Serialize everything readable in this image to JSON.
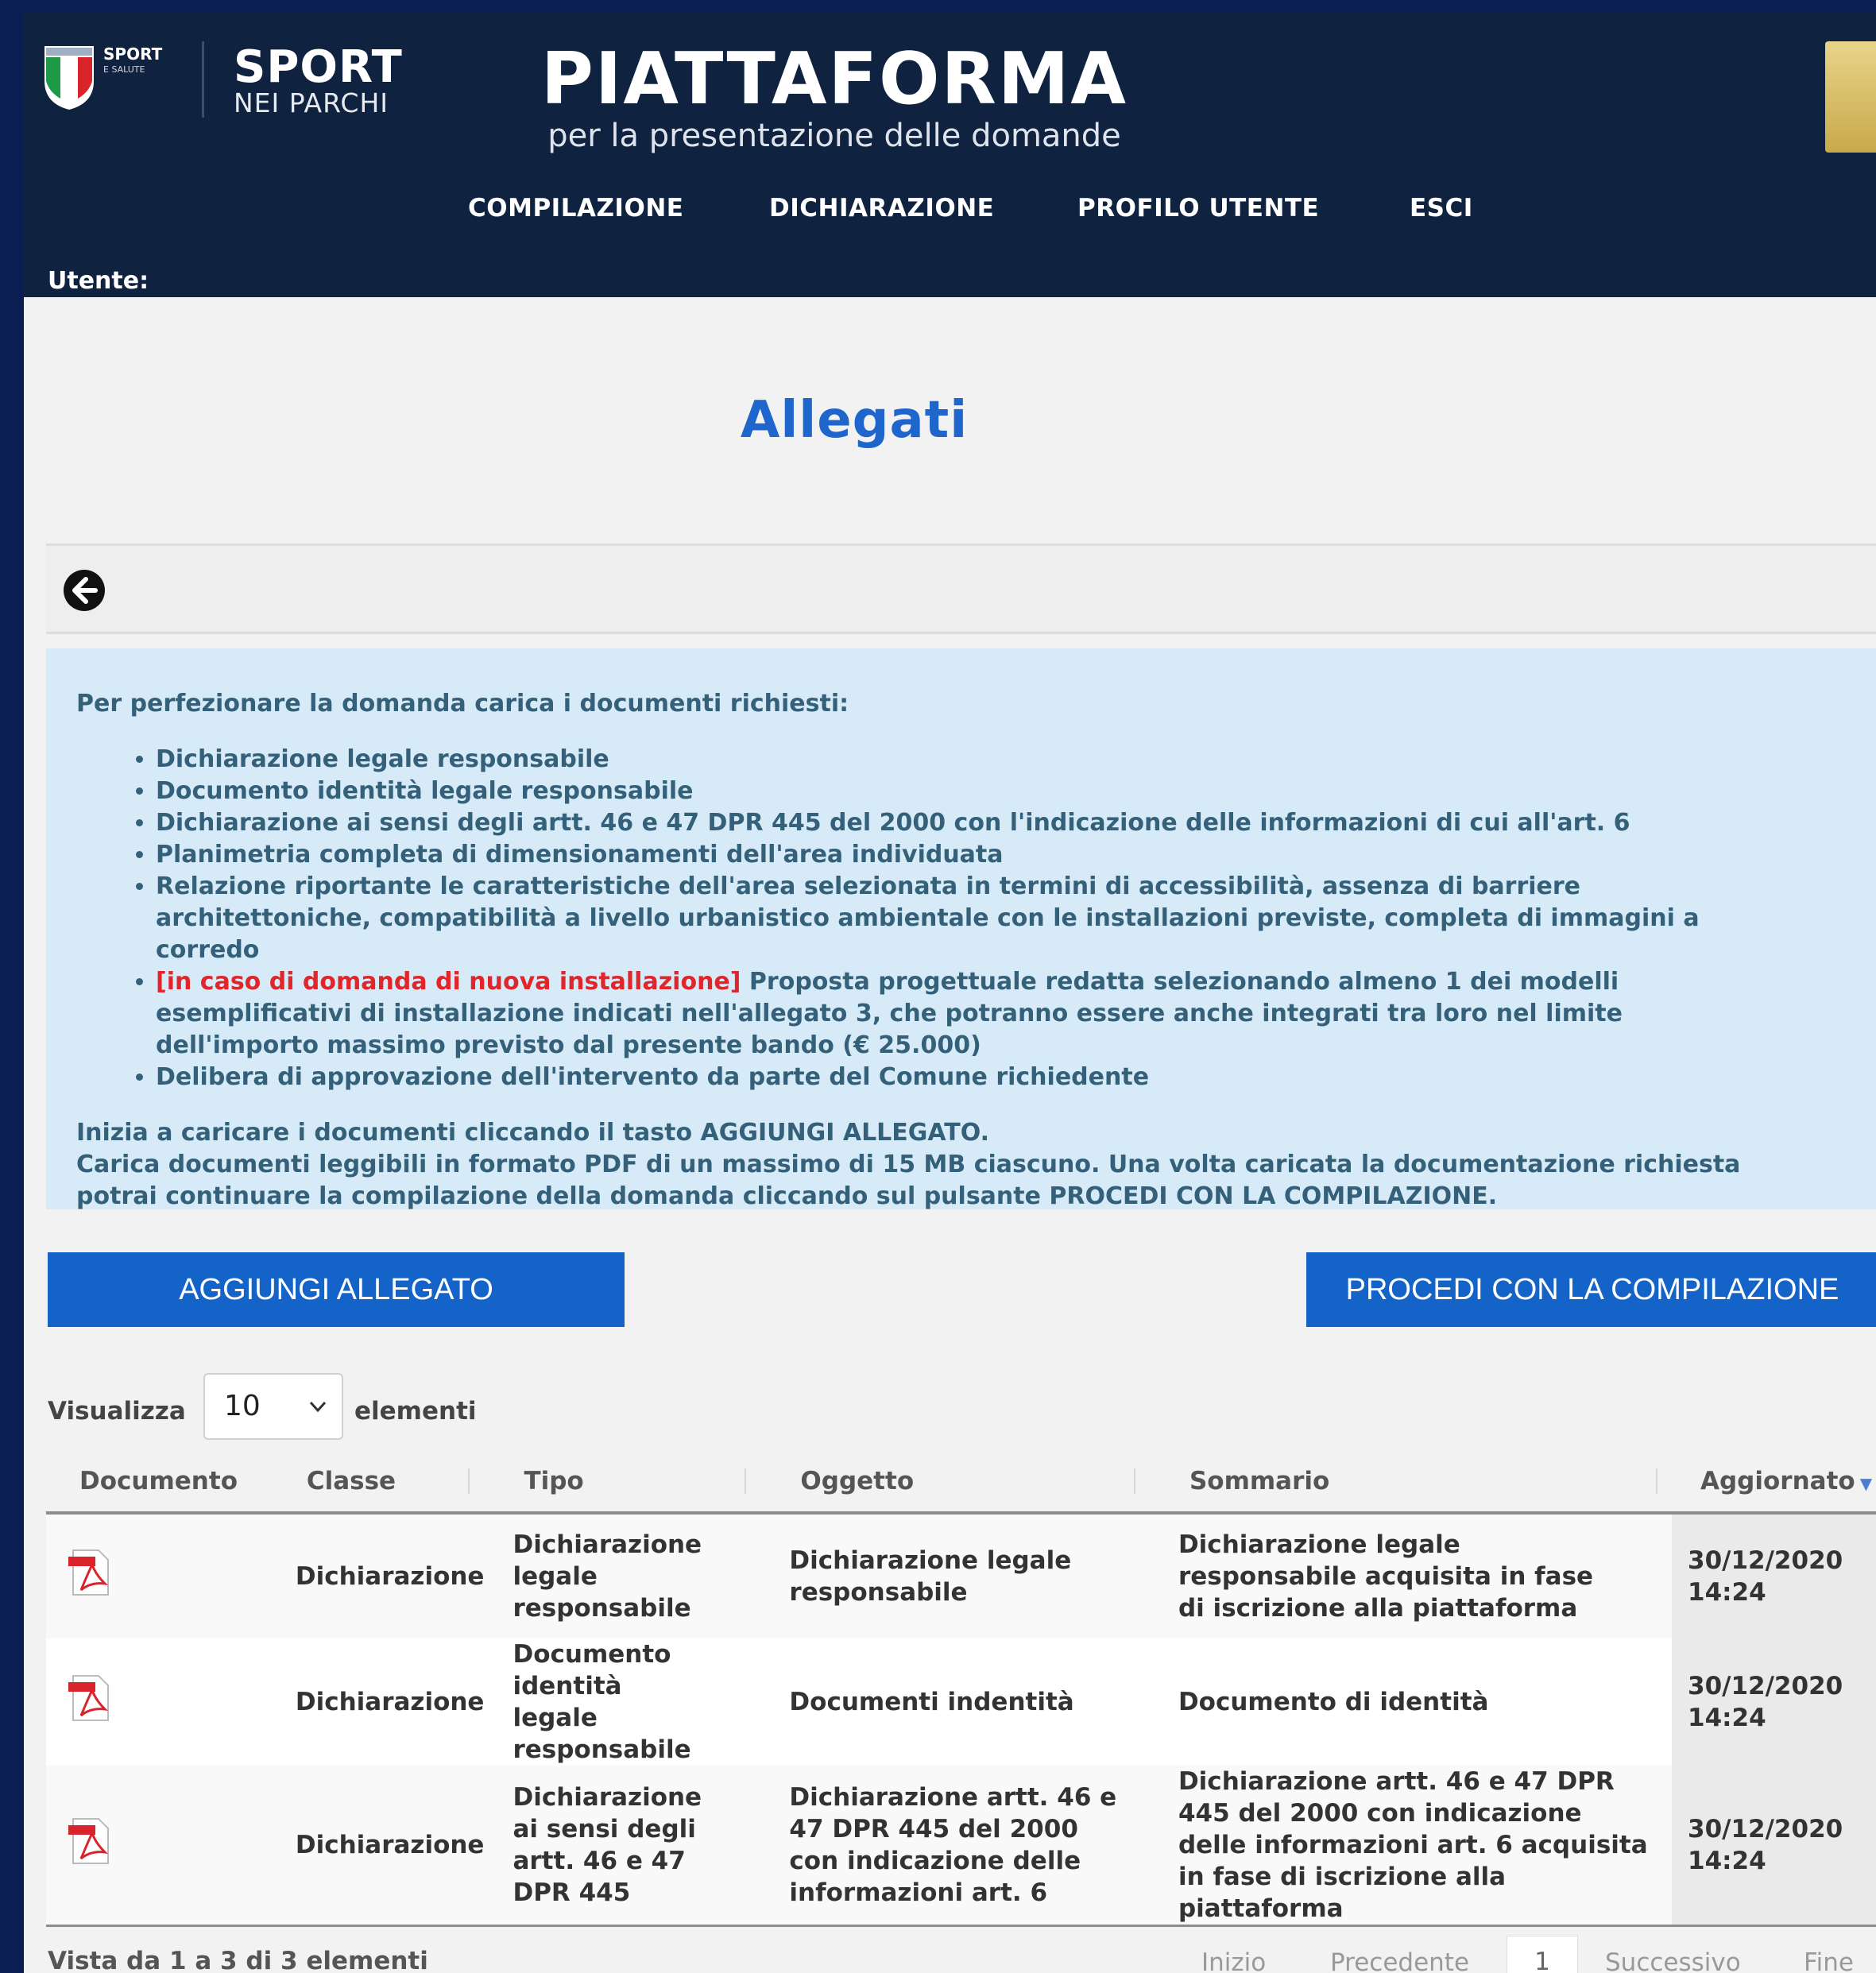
{
  "header": {
    "logo_small": "SPORT",
    "logo_small_sub": "E SALUTE",
    "brand_title": "SPORT",
    "brand_subtitle": "NEI PARCHI",
    "title": "PIATTAFORMA",
    "subtitle": "per la presentazione delle domande",
    "nav": [
      "COMPILAZIONE",
      "DICHIARAZIONE",
      "PROFILO UTENTE",
      "ESCI"
    ],
    "user_label": "Utente:"
  },
  "page_title": "Allegati",
  "toolbar": {
    "back_icon": "arrow-left-circle-icon"
  },
  "info": {
    "intro": "Per perfezionare la domanda carica i documenti richiesti:",
    "items": [
      "Dichiarazione legale responsabile",
      "Documento identità legale responsabile",
      "Dichiarazione ai sensi degli artt. 46 e 47 DPR 445 del 2000 con l'indicazione delle informazioni di cui all'art. 6",
      "Planimetria completa di dimensionamenti dell'area individuata",
      "Relazione riportante le caratteristiche dell'area selezionata in termini di accessibilità, assenza di barriere architettoniche, compatibilità a livello urbanistico ambientale con le installazioni previste, completa di immagini a corredo"
    ],
    "item_red_prefix": "[in caso di domanda di nuova installazione]",
    "item_red_text": " Proposta progettuale redatta selezionando almeno 1 dei modelli esemplificativi di installazione indicati nell'allegato 3, che potranno essere anche integrati tra loro nel limite dell'importo massimo previsto dal presente bando (€ 25.000)",
    "item_last": "Delibera di approvazione dell'intervento da parte del Comune richiedente",
    "footer_line1": "Inizia a caricare i documenti cliccando il tasto AGGIUNGI ALLEGATO.",
    "footer_line2": "Carica documenti leggibili in formato PDF di un massimo di 15 MB ciascuno. Una volta caricata la documentazione richiesta potrai continuare la compilazione della domanda cliccando sul pulsante PROCEDI CON LA COMPILAZIONE."
  },
  "buttons": {
    "add": "AGGIUNGI ALLEGATO",
    "proceed": "PROCEDI CON LA COMPILAZIONE"
  },
  "entries": {
    "prefix": "Visualizza",
    "value": "10",
    "suffix": "elementi"
  },
  "table": {
    "headers": [
      "Documento",
      "Classe",
      "Tipo",
      "Oggetto",
      "Sommario",
      "Aggiornato"
    ],
    "rows": [
      {
        "icon": "pdf-file-icon",
        "classe": "Dichiarazione",
        "tipo": "Dichiarazione legale responsabile",
        "oggetto": "Dichiarazione legale responsabile",
        "sommario": "Dichiarazione legale responsabile acquisita in fase di iscrizione alla piattaforma",
        "aggiornato_date": "30/12/2020",
        "aggiornato_time": "14:24"
      },
      {
        "icon": "pdf-file-icon",
        "classe": "Dichiarazione",
        "tipo": "Documento identità legale responsabile",
        "oggetto": "Documenti indentità",
        "sommario": "Documento di identità",
        "aggiornato_date": "30/12/2020",
        "aggiornato_time": "14:24"
      },
      {
        "icon": "pdf-file-icon",
        "classe": "Dichiarazione",
        "tipo": "Dichiarazione ai sensi degli artt. 46 e 47 DPR 445",
        "oggetto": "Dichiarazione artt. 46 e 47 DPR 445 del 2000 con indicazione delle informazioni art. 6",
        "sommario": "Dichiarazione artt. 46 e 47 DPR 445 del 2000 con indicazione delle informazioni art. 6 acquisita in fase di iscrizione alla piattaforma",
        "aggiornato_date": "30/12/2020",
        "aggiornato_time": "14:24"
      }
    ]
  },
  "footer": {
    "info": "Vista da 1 a 3 di 3 elementi",
    "pager": [
      "Inizio",
      "Precedente",
      "1",
      "Successivo",
      "Fine"
    ]
  },
  "colors": {
    "header_bg": "#0f2240",
    "accent_blue": "#1463c9",
    "title_blue": "#1f66cc",
    "info_bg": "#d6ebf7",
    "info_text": "#35607a",
    "warning_red": "#e0262a"
  }
}
